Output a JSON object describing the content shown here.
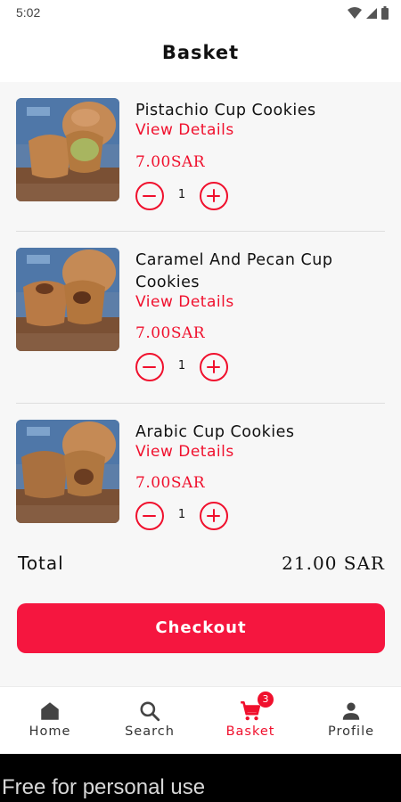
{
  "status_bar": {
    "time": "5:02"
  },
  "header": {
    "title": "Basket"
  },
  "items": [
    {
      "name": "Pistachio Cup Cookies",
      "link": "View Details",
      "price": "7.00SAR",
      "quantity": "1"
    },
    {
      "name": "Caramel And Pecan Cup Cookies",
      "link": "View Details",
      "price": "7.00SAR",
      "quantity": "1"
    },
    {
      "name": "Arabic Cup Cookies",
      "link": "View Details",
      "price": "7.00SAR",
      "quantity": "1"
    }
  ],
  "summary": {
    "total_label": "Total",
    "total_value": "21.00 SAR"
  },
  "checkout": {
    "label": "Checkout"
  },
  "nav": {
    "items": [
      {
        "label": "Home",
        "icon": "home-icon"
      },
      {
        "label": "Search",
        "icon": "search-icon"
      },
      {
        "label": "Basket",
        "icon": "cart-icon",
        "badge": "3",
        "active": true
      },
      {
        "label": "Profile",
        "icon": "person-icon"
      }
    ]
  },
  "colors": {
    "accent": "#f0102d",
    "checkout": "#f5163f"
  },
  "watermark": "Free for personal use"
}
